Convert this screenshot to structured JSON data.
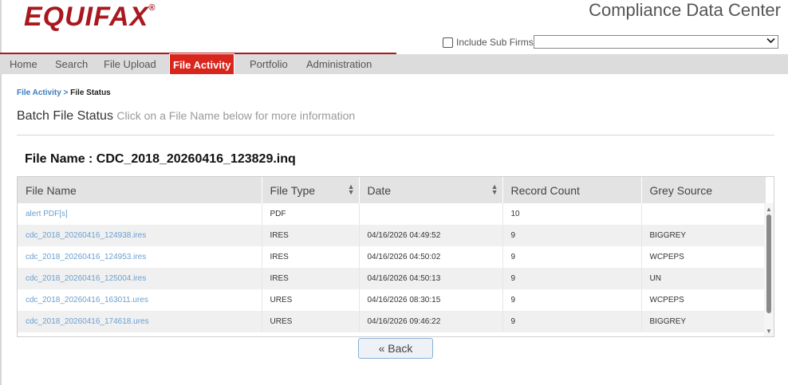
{
  "header": {
    "logo_text": "EQUIFAX",
    "logo_reg": "®",
    "app_title": "Compliance Data Center",
    "include_sub_firms_label": "Include Sub Firms",
    "firm_select_value": ""
  },
  "nav": {
    "items": [
      {
        "label": "Home"
      },
      {
        "label": "Search"
      },
      {
        "label": "File Upload"
      },
      {
        "label": "File Activity",
        "active": true
      },
      {
        "label": "Portfolio"
      },
      {
        "label": "Administration"
      }
    ]
  },
  "breadcrumb": {
    "parent": "File Activity",
    "separator": ">",
    "current": "File Status"
  },
  "page": {
    "title": "Batch File Status",
    "hint": "Click on a File Name below for more information",
    "file_name_heading": "File Name : CDC_2018_20260416_123829.inq"
  },
  "table": {
    "columns": [
      "File Name",
      "File Type",
      "Date",
      "Record Count",
      "Grey Source"
    ],
    "rows": [
      {
        "file_name": "alert PDF[s]",
        "file_type": "PDF",
        "date": "",
        "record_count": "10",
        "grey_source": ""
      },
      {
        "file_name": "cdc_2018_20260416_124938.ires",
        "file_type": "IRES",
        "date": "04/16/2026 04:49:52",
        "record_count": "9",
        "grey_source": "BIGGREY"
      },
      {
        "file_name": "cdc_2018_20260416_124953.ires",
        "file_type": "IRES",
        "date": "04/16/2026 04:50:02",
        "record_count": "9",
        "grey_source": "WCPEPS"
      },
      {
        "file_name": "cdc_2018_20260416_125004.ires",
        "file_type": "IRES",
        "date": "04/16/2026 04:50:13",
        "record_count": "9",
        "grey_source": "UN"
      },
      {
        "file_name": "cdc_2018_20260416_163011.ures",
        "file_type": "URES",
        "date": "04/16/2026 08:30:15",
        "record_count": "9",
        "grey_source": "WCPEPS"
      },
      {
        "file_name": "cdc_2018_20260416_174618.ures",
        "file_type": "URES",
        "date": "04/16/2026 09:46:22",
        "record_count": "9",
        "grey_source": "BIGGREY"
      }
    ]
  },
  "actions": {
    "back_label": "« Back"
  },
  "colors": {
    "brand_red": "#a9181f",
    "nav_active": "#d9261c",
    "link_blue": "#3a7bbf"
  }
}
